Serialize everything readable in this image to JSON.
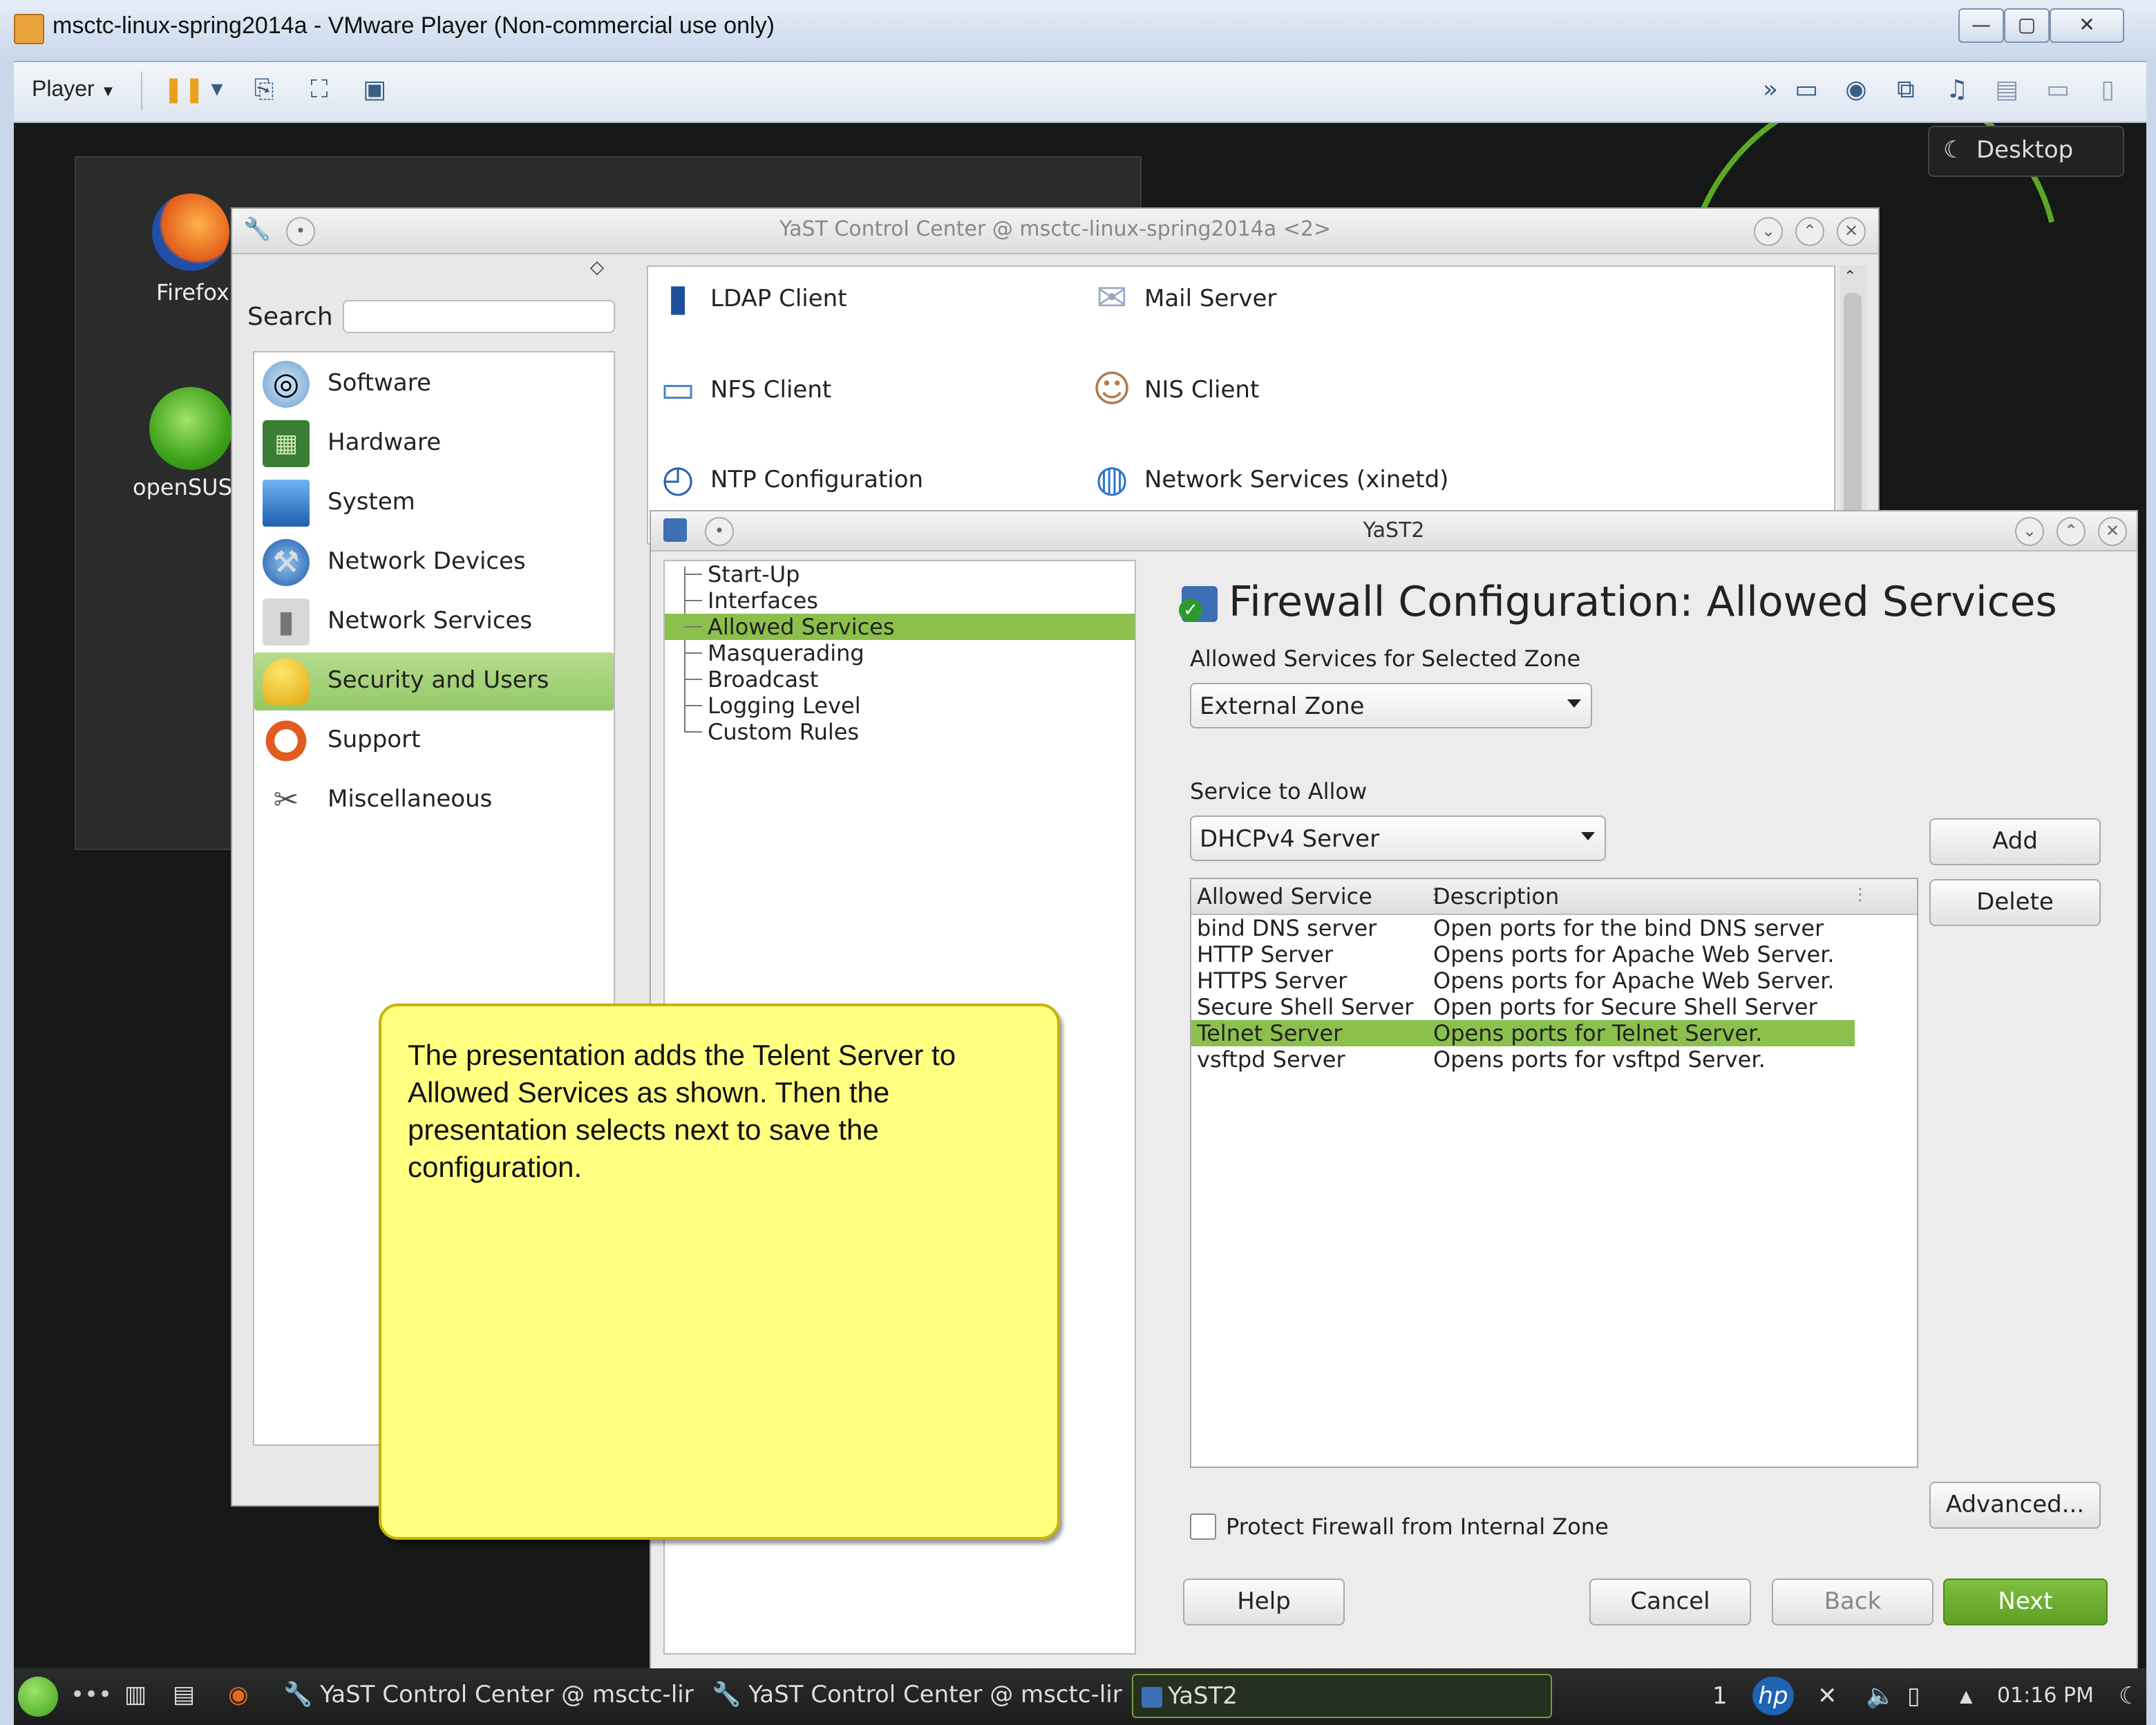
{
  "vmware": {
    "title": "msctc-linux-spring2014a - VMware Player (Non-commercial use only)",
    "toolbar": {
      "player_label": "Player"
    }
  },
  "desktop": {
    "desktop_button": "Desktop",
    "icons": [
      {
        "label": "Firefox"
      },
      {
        "label": "openSUS"
      }
    ]
  },
  "ycc": {
    "title": "YaST Control Center @ msctc-linux-spring2014a <2>",
    "search_label": "Search",
    "search_value": "",
    "categories": [
      {
        "label": "Software"
      },
      {
        "label": "Hardware"
      },
      {
        "label": "System"
      },
      {
        "label": "Network Devices"
      },
      {
        "label": "Network Services"
      },
      {
        "label": "Security and Users"
      },
      {
        "label": "Support"
      },
      {
        "label": "Miscellaneous"
      }
    ],
    "modules": [
      {
        "label": "LDAP Client"
      },
      {
        "label": "Mail Server"
      },
      {
        "label": "NFS Client"
      },
      {
        "label": "NIS Client"
      },
      {
        "label": "NTP Configuration"
      },
      {
        "label": "Network Services (xinetd)"
      }
    ]
  },
  "yast2": {
    "title": "YaST2",
    "tree": [
      {
        "label": "Start-Up"
      },
      {
        "label": "Interfaces"
      },
      {
        "label": "Allowed Services"
      },
      {
        "label": "Masquerading"
      },
      {
        "label": "Broadcast"
      },
      {
        "label": "Logging Level"
      },
      {
        "label": "Custom Rules"
      }
    ],
    "heading": "Firewall Configuration: Allowed Services",
    "zone_label": "Allowed Services for Selected Zone",
    "zone_value": "External Zone",
    "service_label": "Service to Allow",
    "service_value": "DHCPv4 Server",
    "buttons": {
      "add": "Add",
      "delete": "Delete",
      "advanced": "Advanced...",
      "help": "Help",
      "cancel": "Cancel",
      "back": "Back",
      "next": "Next"
    },
    "table": {
      "headers": [
        "Allowed Service",
        "Description"
      ],
      "rows": [
        {
          "service": "bind DNS server",
          "description": "Open ports for the bind DNS server"
        },
        {
          "service": "HTTP Server",
          "description": "Opens ports for Apache Web Server."
        },
        {
          "service": "HTTPS Server",
          "description": "Opens ports for Apache Web Server."
        },
        {
          "service": "Secure Shell Server",
          "description": "Open ports for Secure Shell Server"
        },
        {
          "service": "Telnet Server",
          "description": "Opens ports for Telnet Server."
        },
        {
          "service": "vsftpd Server",
          "description": "Opens ports for vsftpd Server."
        }
      ]
    },
    "protect_label": "Protect Firewall from Internal Zone",
    "protect_checked": false
  },
  "note": {
    "text": "The presentation adds the Telent Server to Allowed Services as shown. Then the presentation selects next to save the configuration."
  },
  "taskbar": {
    "tasks": [
      {
        "label": "YaST Control Center @ msctc-lir"
      },
      {
        "label": "YaST Control Center @ msctc-lir"
      },
      {
        "label": "YaST2"
      }
    ],
    "workspace": "1",
    "clock": "01:16 PM"
  },
  "colors": {
    "selection_green": "#8cc04c",
    "note_yellow": "#ffff80",
    "next_button_green": "#6aac2f"
  }
}
